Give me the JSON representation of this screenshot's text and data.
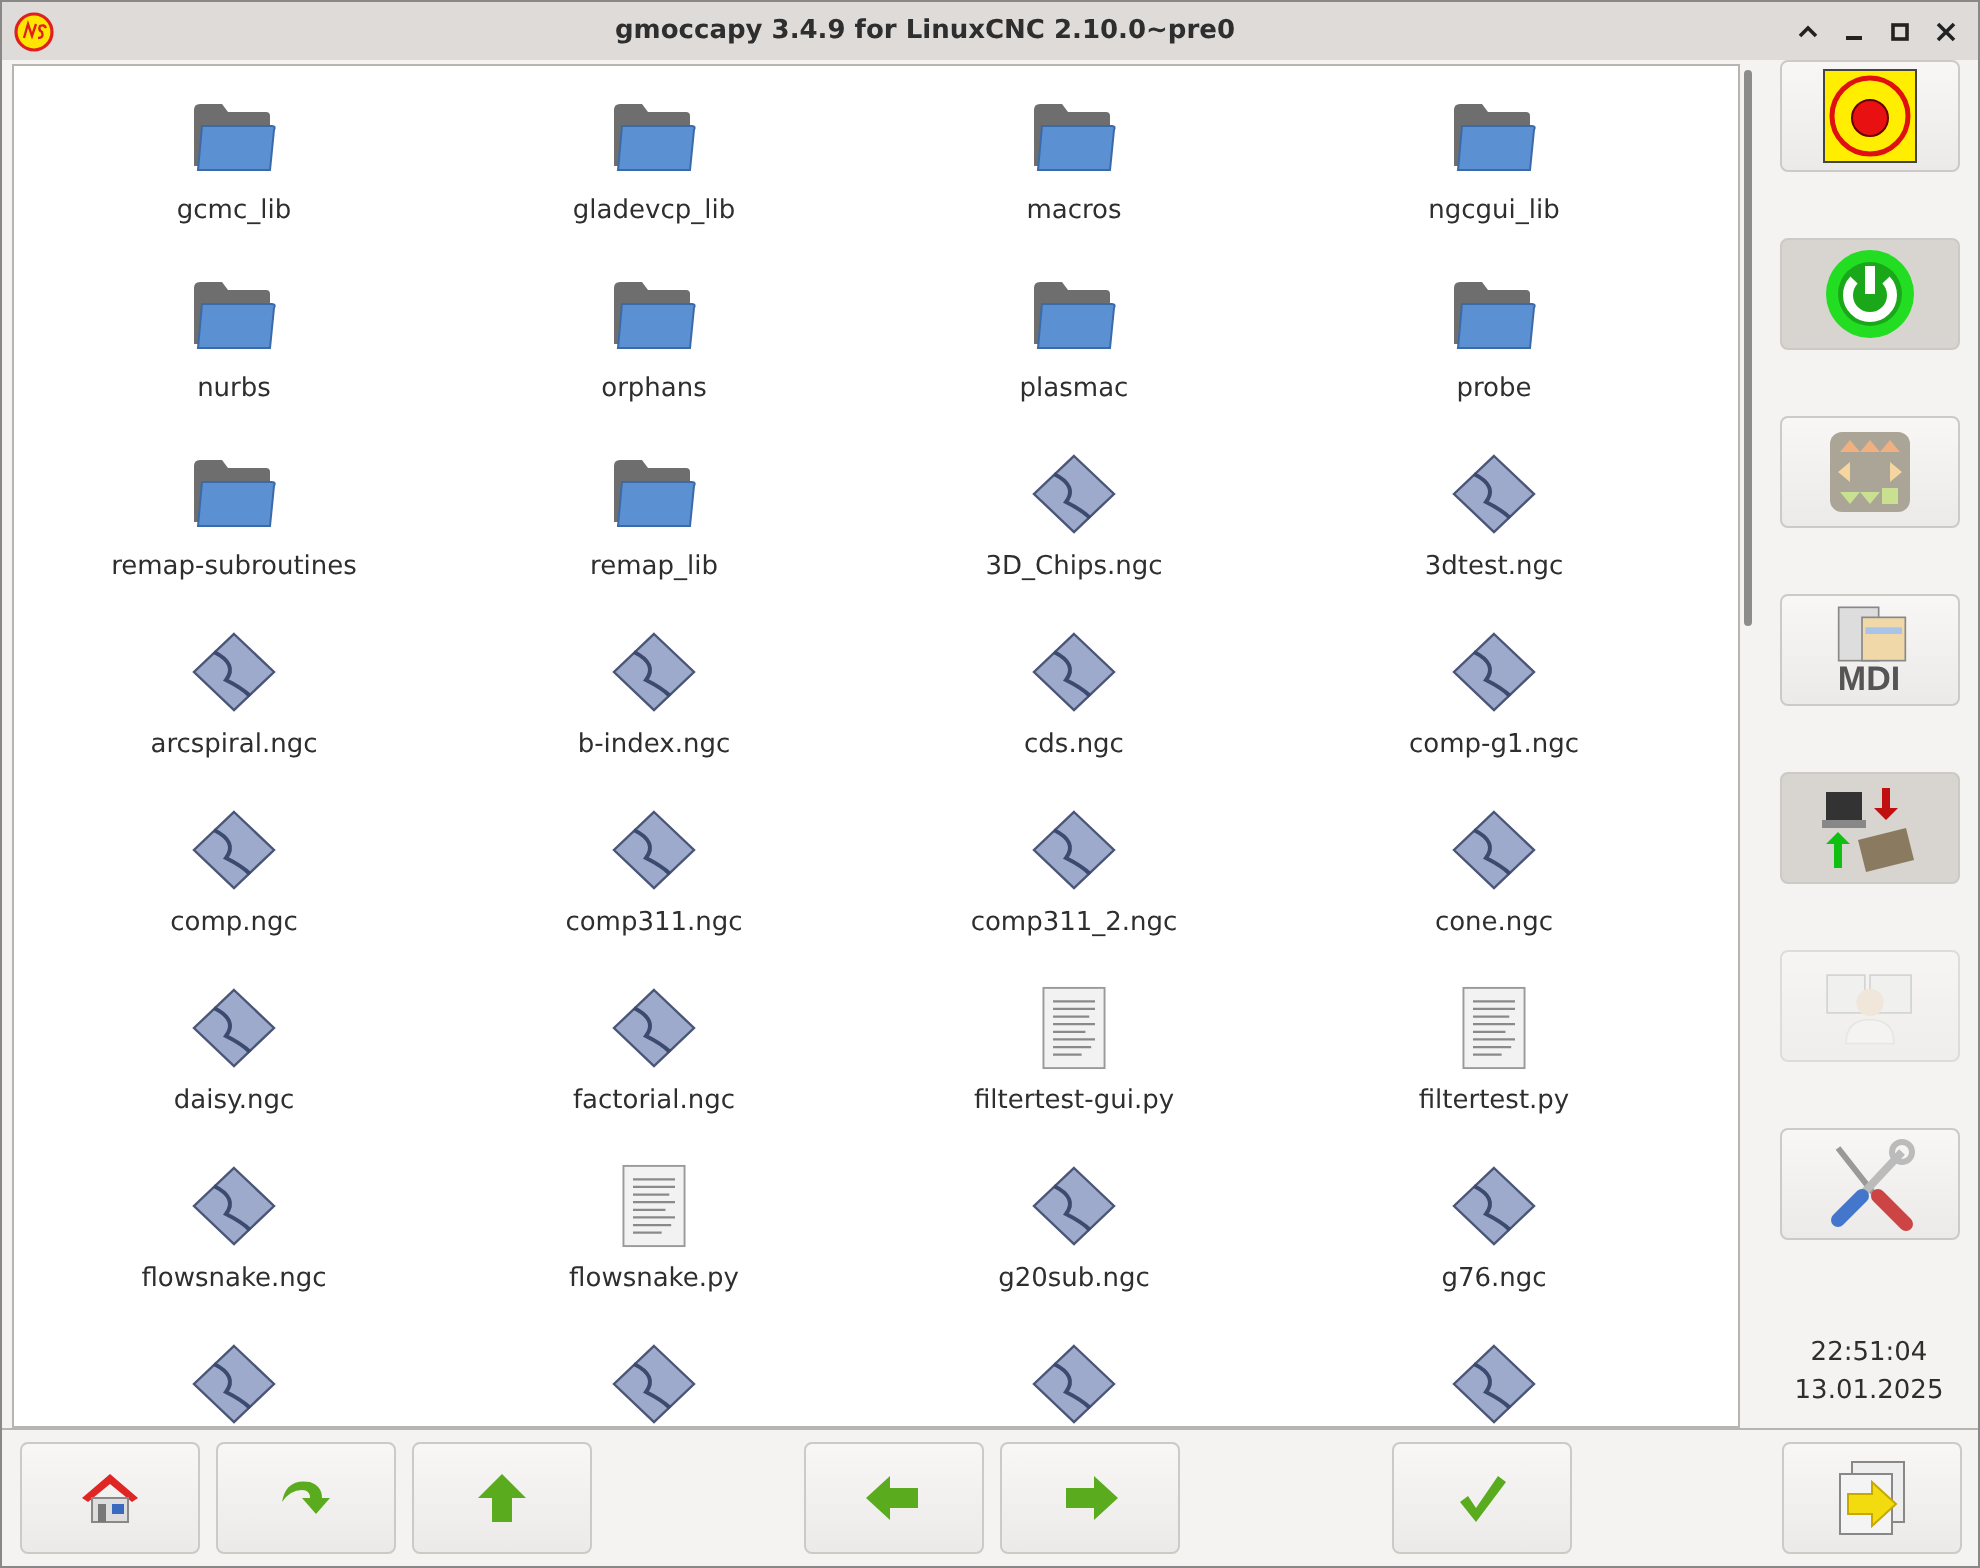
{
  "window": {
    "title": "gmoccapy  3.4.9 for LinuxCNC 2.10.0~pre0"
  },
  "files": [
    {
      "kind": "folder",
      "name": "gcmc_lib"
    },
    {
      "kind": "folder",
      "name": "gladevcp_lib"
    },
    {
      "kind": "folder",
      "name": "macros"
    },
    {
      "kind": "folder",
      "name": "ngcgui_lib"
    },
    {
      "kind": "folder",
      "name": "nurbs"
    },
    {
      "kind": "folder",
      "name": "orphans"
    },
    {
      "kind": "folder",
      "name": "plasmac"
    },
    {
      "kind": "folder",
      "name": "probe"
    },
    {
      "kind": "folder",
      "name": "remap-subroutines"
    },
    {
      "kind": "folder",
      "name": "remap_lib"
    },
    {
      "kind": "ngc",
      "name": "3D_Chips.ngc"
    },
    {
      "kind": "ngc",
      "name": "3dtest.ngc"
    },
    {
      "kind": "ngc",
      "name": "arcspiral.ngc"
    },
    {
      "kind": "ngc",
      "name": "b-index.ngc"
    },
    {
      "kind": "ngc",
      "name": "cds.ngc"
    },
    {
      "kind": "ngc",
      "name": "comp-g1.ngc"
    },
    {
      "kind": "ngc",
      "name": "comp.ngc"
    },
    {
      "kind": "ngc",
      "name": "comp311.ngc"
    },
    {
      "kind": "ngc",
      "name": "comp311_2.ngc"
    },
    {
      "kind": "ngc",
      "name": "cone.ngc"
    },
    {
      "kind": "ngc",
      "name": "daisy.ngc"
    },
    {
      "kind": "ngc",
      "name": "factorial.ngc"
    },
    {
      "kind": "py",
      "name": "filtertest-gui.py"
    },
    {
      "kind": "py",
      "name": "filtertest.py"
    },
    {
      "kind": "ngc",
      "name": "flowsnake.ngc"
    },
    {
      "kind": "py",
      "name": "flowsnake.py"
    },
    {
      "kind": "ngc",
      "name": "g20sub.ngc"
    },
    {
      "kind": "ngc",
      "name": "g76.ngc"
    },
    {
      "kind": "ngc"
    },
    {
      "kind": "ngc"
    },
    {
      "kind": "ngc"
    },
    {
      "kind": "ngc"
    }
  ],
  "side_buttons": [
    {
      "kind": "estop",
      "selected": false,
      "disabled": false
    },
    {
      "kind": "power",
      "selected": true,
      "disabled": false
    },
    {
      "kind": "jog",
      "selected": false,
      "disabled": false
    },
    {
      "kind": "mdi",
      "label": "MDI",
      "selected": false,
      "disabled": false
    },
    {
      "kind": "auto",
      "selected": true,
      "disabled": false
    },
    {
      "kind": "user",
      "selected": false,
      "disabled": true
    },
    {
      "kind": "settings",
      "selected": false,
      "disabled": false
    }
  ],
  "clock": {
    "time": "22:51:04",
    "date": "13.01.2025"
  },
  "bottom_buttons": [
    {
      "kind": "home"
    },
    {
      "kind": "reload"
    },
    {
      "kind": "up"
    },
    {
      "kind": "gap"
    },
    {
      "kind": "back"
    },
    {
      "kind": "forward"
    },
    {
      "kind": "gap"
    },
    {
      "kind": "ok"
    }
  ]
}
